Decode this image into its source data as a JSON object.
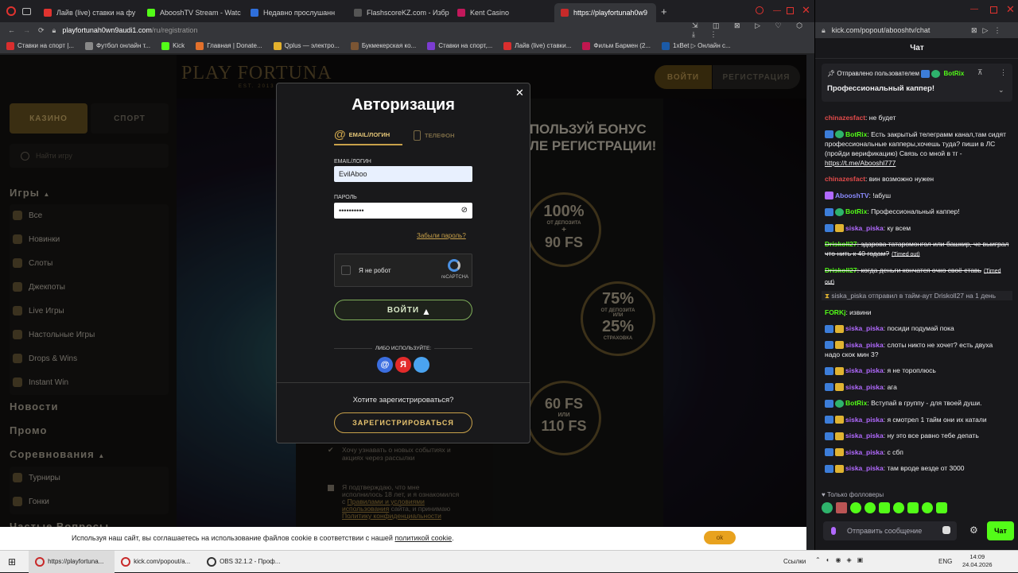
{
  "left_browser": {
    "tabs": [
      {
        "label": "Лайв (live) ставки на фу",
        "color": "#e0332f"
      },
      {
        "label": "AbooshTV Stream - Watc",
        "color": "#53fc18"
      },
      {
        "label": "Недавно прослушанн",
        "color": "#2f6fdb"
      },
      {
        "label": "FlashscoreKZ.com - Избр",
        "color": "#555"
      },
      {
        "label": "Kent Casino",
        "color": "#c2185b"
      },
      {
        "label": "https://playfortunah0w9",
        "color": "#c82a2a"
      }
    ],
    "address": "playfortunah0wn9audi1.com",
    "address_path": "/ru/registration",
    "bookmarks": [
      {
        "label": "Ставки на спорт |...",
        "color": "#d92e2e"
      },
      {
        "label": "Футбол онлайн т...",
        "color": "#888"
      },
      {
        "label": "Kick",
        "color": "#53fc18"
      },
      {
        "label": "Главная | Donate...",
        "color": "#e2702b"
      },
      {
        "label": "Qplus — электро...",
        "color": "#e3b12d"
      },
      {
        "label": "Букмекерская ко...",
        "color": "#7b5533"
      },
      {
        "label": "Ставки на спорт,...",
        "color": "#7c3cd1"
      },
      {
        "label": "Лайв (live) ставки...",
        "color": "#d92e2e"
      },
      {
        "label": "Фильм Бармен (2...",
        "color": "#c0174f"
      },
      {
        "label": "1xBet ▷ Онлайн с...",
        "color": "#1b5aa6"
      }
    ]
  },
  "site": {
    "logo": "PLAY FORTUNA",
    "logo_sub": "EST. 2013",
    "login_btn": "ВОЙТИ",
    "register_btn": "РЕГИСТРАЦИЯ",
    "sidebar": {
      "casino": "КАЗИНО",
      "sport": "СПОРТ",
      "search_placeholder": "Найти игру",
      "games_heading": "Игры",
      "games": [
        "Все",
        "Новинки",
        "Слоты",
        "Джекпоты",
        "Live Игры",
        "Настольные Игры",
        "Drops & Wins",
        "Instant Win"
      ],
      "news": "Новости",
      "promo": "Промо",
      "tournaments_heading": "Соревнования",
      "tournaments": [
        "Турниры",
        "Гонки"
      ],
      "faq": "Частые Вопросы"
    },
    "promo": {
      "headline1": "ИСПОЛЬЗУЙ БОНУС",
      "headline2": "ПОСЛЕ РЕГИСТРАЦИИ!",
      "c1_big": "100%",
      "c1_small": "ОТ ДЕПОЗИТА",
      "c1_plus": "+",
      "c1_fs": "90 FS",
      "c2_big": "75%",
      "c2_small": "ОТ ДЕПОЗИТА",
      "c2_or": "ИЛИ",
      "c2_big2": "25%",
      "c2_small2": "СТРАХОВКА",
      "c3_big": "60 FS",
      "c3_or": "ИЛИ",
      "c3_big2": "110 FS"
    },
    "checkbox1": "Хочу узнавать о новых событиях и акциях через рассылки",
    "checkbox2_text": "Я подтверждаю, что мне исполнилось 18 лет, и я ознакомился с",
    "checkbox2_link": "Правилами и условиями использования",
    "checkbox2_text2": "сайта, и принимаю",
    "checkbox2_link2": "Политику конфиденциальности"
  },
  "modal": {
    "title": "Авторизация",
    "tab_email": "EMAIL/ЛОГИН",
    "tab_phone": "ТЕЛЕФОН",
    "email_label": "EMAIL/ЛОГИН",
    "email_value": "EvilAboo",
    "password_label": "ПАРОЛЬ",
    "password_value": "••••••••••",
    "forgot": "Забыли пароль?",
    "captcha_label": "Я не робот",
    "captcha_brand": "reCAPTCHA",
    "login": "ВОЙТИ",
    "or_use": "ЛИБО ИСПОЛЬЗУЙТЕ:",
    "social": [
      {
        "name": "mail",
        "color": "#3b6ee0",
        "glyph": "@"
      },
      {
        "name": "yandex",
        "color": "#e32b2b",
        "glyph": "Я"
      },
      {
        "name": "other",
        "color": "#4aa3f0",
        "glyph": ""
      }
    ],
    "want_register": "Хотите зарегистрироваться?",
    "register": "ЗАРЕГИСТРИРОВАТЬСЯ"
  },
  "cookie": {
    "text_before": "Используя наш сайт, вы соглашаетесь на использование файлов cookie в соответствии с нашей",
    "link": "политикой cookie",
    "text_after": ".",
    "ok": "ok"
  },
  "right_browser": {
    "address": "kick.com/popout/abooshtv/chat",
    "chat_title": "Чат",
    "pinned_by": "Отправлено пользователем",
    "pinned_user": "BotRix",
    "pinned_text": "Профессиональный каппер!",
    "messages": [
      {
        "user": "chinazesfact",
        "ucls": "u-red",
        "badges": [],
        "text": ": не будет"
      },
      {
        "user": "BotRix",
        "ucls": "u-green",
        "badges": [
          "b-blue",
          "b-green"
        ],
        "text": ": Есть закрытый телеграмм канал,там сидят профессиональные капперы,хочешь туда? пиши в ЛС (пройди верификацию) Связь со мной в тг -",
        "link": "https://t.me/Abooshl777"
      },
      {
        "user": "chinazesfact",
        "ucls": "u-red",
        "badges": [],
        "text": ": вин возможно нужен"
      },
      {
        "user": "AbooshTV",
        "ucls": "u-blue",
        "badges": [
          "b-purple"
        ],
        "text": ": !абуш"
      },
      {
        "user": "BotRix",
        "ucls": "u-green",
        "badges": [
          "b-blue",
          "b-green"
        ],
        "text": ": Профессиональный каппер!"
      },
      {
        "user": "siska_piska",
        "ucls": "u-purple",
        "badges": [
          "b-blue",
          "b-gold"
        ],
        "text": ": ку всем"
      },
      {
        "user": "Driskoll27",
        "ucls": "u-green",
        "badges": [],
        "text": ": здарова татаромонгол или башкир, че выиграл что нить к 40 годам?",
        "timeout": "(Timed out)"
      },
      {
        "user": "Driskoll27",
        "ucls": "u-green",
        "badges": [],
        "text": ": когда деньги кончатся очко своё ставь",
        "timeout": "(Timed out)"
      },
      {
        "system": "siska_piska отправил в тайм-аут Driskoll27 на 1 день"
      },
      {
        "user": "FORKj",
        "ucls": "u-green",
        "badges": [],
        "text": ": извини"
      },
      {
        "user": "siska_piska",
        "ucls": "u-purple",
        "badges": [
          "b-blue",
          "b-gold"
        ],
        "text": ": посиди подумай пока"
      },
      {
        "user": "siska_piska",
        "ucls": "u-purple",
        "badges": [
          "b-blue",
          "b-gold"
        ],
        "text": ": слоты никто не хочет? есть двуха надо скок мин 3?"
      },
      {
        "user": "siska_piska",
        "ucls": "u-purple",
        "badges": [
          "b-blue",
          "b-gold"
        ],
        "text": ": я не тороплюсь"
      },
      {
        "user": "siska_piska",
        "ucls": "u-purple",
        "badges": [
          "b-blue",
          "b-gold"
        ],
        "text": ": ага"
      },
      {
        "user": "BotRix",
        "ucls": "u-green",
        "badges": [
          "b-blue",
          "b-green"
        ],
        "text": ": Вступай в группу - для твоей души."
      },
      {
        "user": "siska_piska",
        "ucls": "u-purple",
        "badges": [
          "b-blue",
          "b-gold"
        ],
        "text": ": я смотрел 1 тайм они их катали"
      },
      {
        "user": "siska_piska",
        "ucls": "u-purple",
        "badges": [
          "b-blue",
          "b-gold"
        ],
        "text": ": ну это все равно тебе депать"
      },
      {
        "user": "siska_piska",
        "ucls": "u-purple",
        "badges": [
          "b-blue",
          "b-gold"
        ],
        "text": ": с сбп"
      },
      {
        "user": "siska_piska",
        "ucls": "u-purple",
        "badges": [
          "b-blue",
          "b-gold"
        ],
        "text": ": там вроде везде от 3000"
      }
    ],
    "followers_only": "Только фолловеры",
    "send_placeholder": "Отправить сообщение",
    "chat_button": "Чат"
  },
  "taskbar": {
    "items": [
      {
        "label": "https://playfortuna...",
        "color": "#c82a2a",
        "active": true
      },
      {
        "label": "kick.com/popout/a...",
        "color": "#c82a2a",
        "active": false
      },
      {
        "label": "OBS 32.1.2 - Проф...",
        "color": "#333",
        "active": false
      }
    ],
    "links_label": "Ссылки",
    "lang": "ENG",
    "time": "14:09",
    "date": "24.04.2026"
  }
}
